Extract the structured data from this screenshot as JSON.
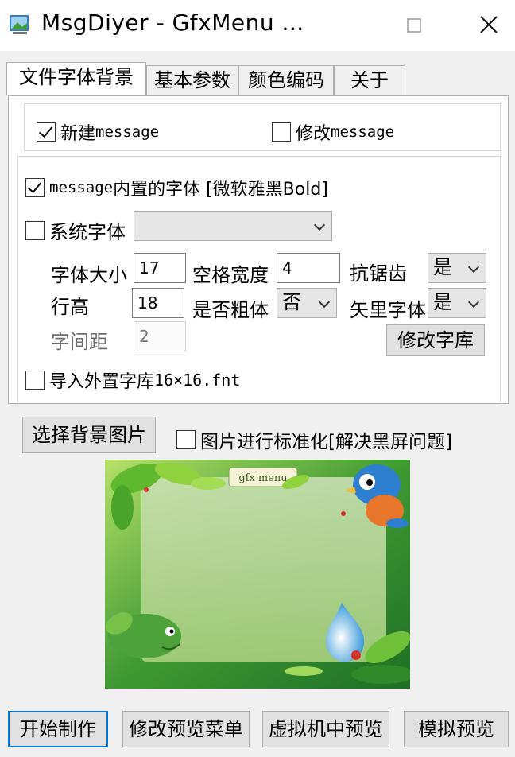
{
  "window": {
    "title": "MsgDiyer - GfxMenu ..."
  },
  "tabs": [
    {
      "label": "文件字体背景",
      "active": true
    },
    {
      "label": "基本参数",
      "active": false
    },
    {
      "label": "颜色编码",
      "active": false
    },
    {
      "label": "关于",
      "active": false
    }
  ],
  "message_group": {
    "new_message": {
      "label": "新建",
      "suffix": "message",
      "checked": true
    },
    "edit_message": {
      "label": "修改",
      "suffix": "message",
      "checked": false
    }
  },
  "font_group": {
    "builtin_font": {
      "prefix": "message",
      "label": "内置的字体 [微软雅黑Bold]",
      "checked": true
    },
    "system_font": {
      "label": "系统字体",
      "checked": false,
      "selected": ""
    },
    "font_size": {
      "label": "字体大小",
      "value": "17"
    },
    "space_width": {
      "label": "空格宽度",
      "value": "4"
    },
    "antialias": {
      "label": "抗锯齿",
      "selected": "是"
    },
    "line_height": {
      "label": "行高",
      "value": "18"
    },
    "bold": {
      "label": "是否粗体",
      "selected": "否"
    },
    "vector_font": {
      "label": "矢里字体",
      "selected": "是"
    },
    "char_spacing": {
      "label": "字间距",
      "value": "2"
    },
    "edit_font_lib_button": "修改字库",
    "import_font": {
      "label": "导入外置字库",
      "suffix": "16×16.fnt",
      "checked": false
    }
  },
  "background": {
    "choose_button": "选择背景图片",
    "normalize": {
      "label": "图片进行标准化[解决黑屏问题]",
      "checked": false
    },
    "sign_text": "gfx menu"
  },
  "footer": {
    "start_button": "开始制作",
    "edit_preview_button": "修改预览菜单",
    "vm_preview_button": "虚拟机中预览",
    "sim_preview_button": "模拟预览"
  },
  "colors": {
    "accent": "#0078d7",
    "window_bg": "#f0f0f0",
    "leaf_green": "#4a9a2a",
    "bird_blue": "#2f7fd1",
    "bird_orange": "#e8762a"
  }
}
